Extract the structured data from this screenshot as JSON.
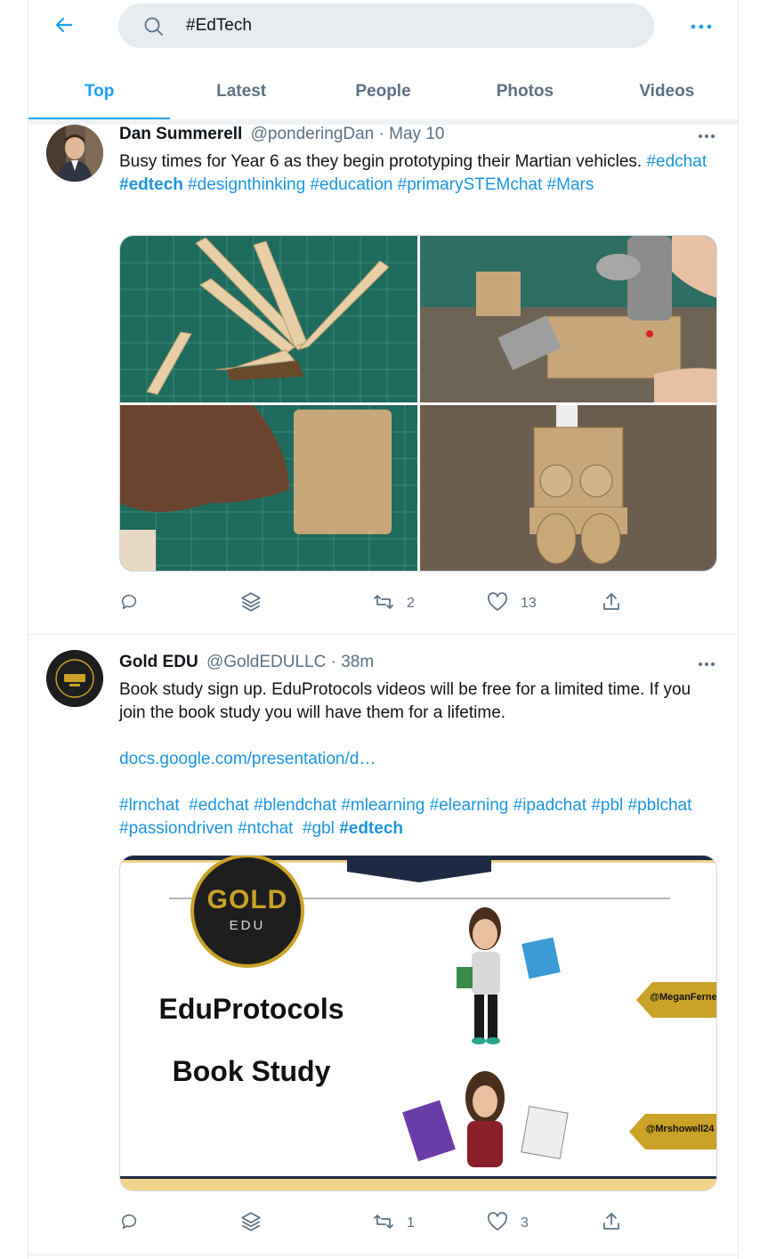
{
  "search": {
    "value": "#EdTech"
  },
  "tabs": [
    {
      "label": "Top",
      "active": true
    },
    {
      "label": "Latest",
      "active": false
    },
    {
      "label": "People",
      "active": false
    },
    {
      "label": "Photos",
      "active": false
    },
    {
      "label": "Videos",
      "active": false
    }
  ],
  "colors": {
    "accent": "#1da1f2",
    "link": "#1b95e0",
    "muted": "#5b7083"
  },
  "tweets": [
    {
      "name": "Dan Summerell",
      "meta": "@ponderingDan · May 10",
      "text_plain": "Busy times for Year 6 as they begin prototyping their Martian vehicles.",
      "tags": [
        "#edchat",
        "#edtech",
        "#designthinking",
        "#education",
        "#primarySTEMchat",
        "#Mars"
      ],
      "retweets": "2",
      "likes": "13"
    },
    {
      "name": "Gold EDU",
      "meta": "@GoldEDULLC · 38m",
      "text_plain": "Book study sign up. EduProtocols videos will be free for a limited time. If you join the book study you will have them for a lifetime.",
      "link": "docs.google.com/presentation/d…",
      "tags": [
        "#lrnchat",
        "#edchat",
        "#blendchat",
        "#mlearning",
        "#elearning",
        "#ipadchat",
        "#pbl",
        "#pblchat",
        "#passiondriven",
        "#ntchat",
        "#gbl",
        "#edtech"
      ],
      "retweets": "1",
      "likes": "3",
      "card": {
        "logo_top": "GOLD",
        "logo_bottom": "EDU",
        "title_line1": "EduProtocols",
        "title_line2": "Book Study",
        "handle1": "@MeganFerne",
        "handle2": "@Mrshowell24"
      }
    }
  ]
}
